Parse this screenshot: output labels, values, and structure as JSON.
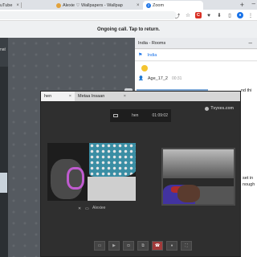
{
  "browser": {
    "tabs": [
      {
        "label": "uTube",
        "active": false
      },
      {
        "label": "Alexie ♡ Wallpapers - Wallpap",
        "active": false
      },
      {
        "label": "Zoom",
        "active": true
      }
    ],
    "new_tab": "+",
    "window_controls": "–",
    "toolbar_icons": [
      "share-icon",
      "star-icon",
      "extension-red-icon",
      "puzzle-icon",
      "download-icon",
      "bookmark-icon",
      "profile-icon",
      "menu-icon"
    ]
  },
  "call_banner": {
    "text": "Ongoing call. Tap to return."
  },
  "left_pane": {
    "label": "nat"
  },
  "india_window": {
    "title": "India - Rooms",
    "room_name": "India",
    "message_user": "Age_17_2",
    "message_time": "00:31",
    "snippet_1": "nd thi",
    "snippet_2": "set in",
    "snippet_3": "nough"
  },
  "call_window": {
    "tabs": [
      {
        "label": "hen",
        "active": true
      },
      {
        "label": "Metaa Insaan",
        "active": false
      }
    ],
    "brand": "Tvyxes.com",
    "status_name": "hen",
    "timer": "01:09:02",
    "peer_name": "Alexiee",
    "controls": [
      "screen",
      "video",
      "camera",
      "screen-share",
      "hang-up",
      "mic",
      "fullscreen"
    ]
  },
  "colors": {
    "hangup": "#a13a3a",
    "link_blue": "#1a73e8",
    "hair_accent": "#c05bd0"
  }
}
